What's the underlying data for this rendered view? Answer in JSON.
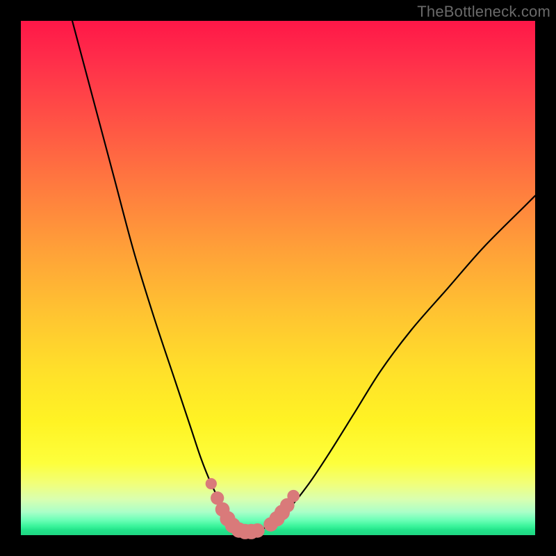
{
  "watermark": "TheBottleneck.com",
  "chart_data": {
    "type": "line",
    "title": "",
    "xlabel": "",
    "ylabel": "",
    "xlim": [
      0,
      100
    ],
    "ylim": [
      0,
      100
    ],
    "grid": false,
    "series": [
      {
        "name": "bottleneck-curve",
        "color": "#000000",
        "x": [
          10,
          14,
          18,
          22,
          26,
          30,
          33,
          35,
          37,
          39,
          40.5,
          42,
          43.5,
          45,
          47,
          49,
          52,
          56,
          60,
          65,
          70,
          76,
          83,
          90,
          98,
          100
        ],
        "y": [
          100,
          85,
          70,
          55,
          42,
          30,
          21,
          15,
          10,
          6,
          3.2,
          1.5,
          0.6,
          0.6,
          1.2,
          2.4,
          5,
          10,
          16,
          24,
          32,
          40,
          48,
          56,
          64,
          66
        ]
      }
    ],
    "markers": [
      {
        "name": "left-cluster",
        "color": "#d97a7a",
        "points": [
          {
            "x": 37.0,
            "y": 10.0,
            "r": 1.1
          },
          {
            "x": 38.2,
            "y": 7.2,
            "r": 1.3
          },
          {
            "x": 39.2,
            "y": 5.0,
            "r": 1.4
          },
          {
            "x": 40.2,
            "y": 3.2,
            "r": 1.5
          },
          {
            "x": 41.2,
            "y": 1.9,
            "r": 1.5
          },
          {
            "x": 42.4,
            "y": 1.0,
            "r": 1.5
          },
          {
            "x": 43.6,
            "y": 0.7,
            "r": 1.5
          },
          {
            "x": 44.8,
            "y": 0.7,
            "r": 1.5
          },
          {
            "x": 46.0,
            "y": 0.9,
            "r": 1.4
          }
        ]
      },
      {
        "name": "right-cluster",
        "color": "#d97a7a",
        "points": [
          {
            "x": 48.6,
            "y": 2.1,
            "r": 1.4
          },
          {
            "x": 49.8,
            "y": 3.2,
            "r": 1.5
          },
          {
            "x": 50.8,
            "y": 4.4,
            "r": 1.5
          },
          {
            "x": 51.8,
            "y": 5.8,
            "r": 1.4
          },
          {
            "x": 53.0,
            "y": 7.6,
            "r": 1.2
          }
        ]
      }
    ]
  },
  "colors": {
    "frame": "#000000",
    "watermark": "#6a6a6a",
    "curve": "#000000",
    "marker": "#d97a7a"
  }
}
